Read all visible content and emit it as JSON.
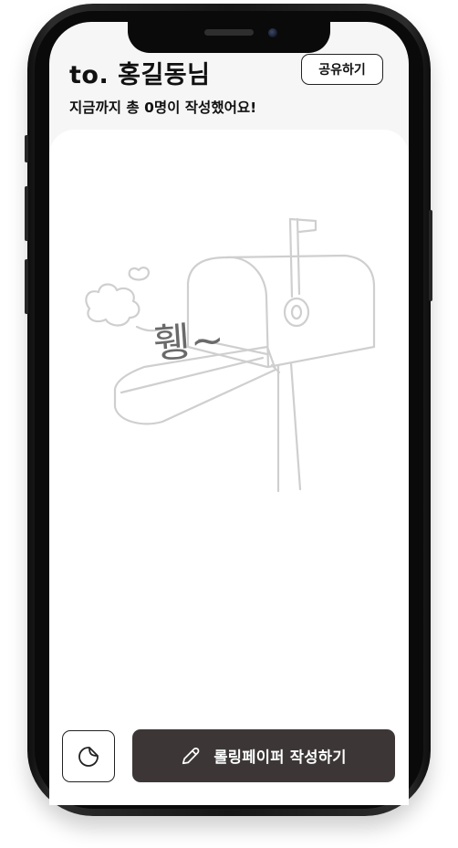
{
  "header": {
    "title": "to. 홍길동님",
    "subtitle": "지금까지 총 0명이 작성했어요!",
    "share_label": "공유하기"
  },
  "empty_state": {
    "handwriting": "휑~"
  },
  "bottom_bar": {
    "sticker_icon": "sticker-icon",
    "write_label": "롤링페이퍼 작성하기",
    "write_icon": "pencil-icon"
  }
}
